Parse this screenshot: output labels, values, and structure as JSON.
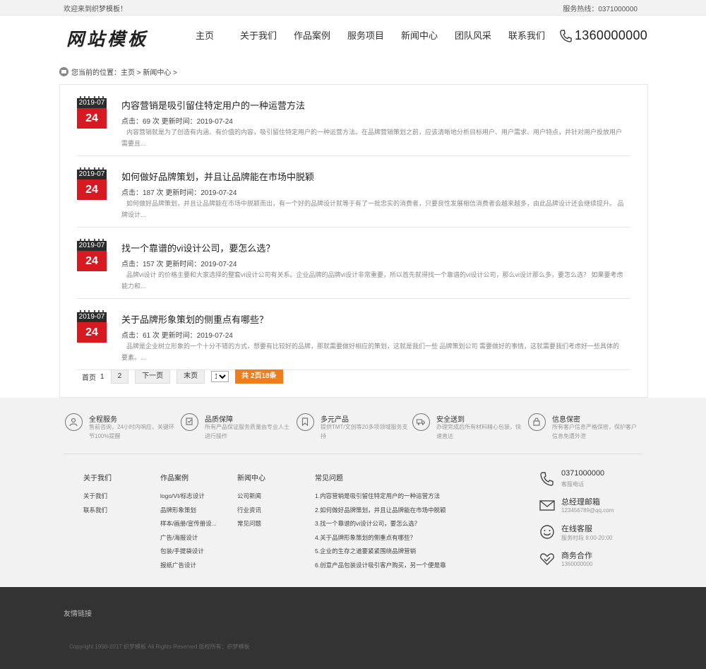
{
  "topbar": {
    "welcome": "欢迎来到织梦模板！",
    "hotline": "服务热线：0371000000"
  },
  "header": {
    "logo": "网站模板",
    "nav": [
      "主页",
      "关于我们",
      "作品案例",
      "服务项目",
      "新闻中心",
      "团队风采",
      "联系我们"
    ],
    "phone": "1360000000"
  },
  "breadcrumb": "您当前的位置：主页 > 新闻中心 >",
  "articles": [
    {
      "ym": "2019-07",
      "day": "24",
      "title": "内容营销是吸引留住特定用户的一种运营方法",
      "meta": "点击：69 次  更新时间：2019-07-24",
      "desc": "内容营销就是为了创造有内涵、有价值的内容，吸引留住特定用户的一种运营方法。在品牌营销策划之前，应该清晰地分析目标用户、用户需求、用户特点，并针对用户投放用户需要且..."
    },
    {
      "ym": "2019-07",
      "day": "24",
      "title": "如何做好品牌策划，并且让品牌能在市场中脱颖",
      "meta": "点击：187 次  更新时间：2019-07-24",
      "desc": "如何做好品牌策划，并且让品牌能在市场中脱颖而出，有一个好的品牌设计就等于有了一批忠实的消费者，只要良性发展相信消费者会越来越多，由此品牌设计还会继续提升。 品牌设计..."
    },
    {
      "ym": "2019-07",
      "day": "24",
      "title": "找一个靠谱的vi设计公司，要怎么选？",
      "meta": "点击：157 次  更新时间：2019-07-24",
      "desc": "品牌vi设计 的价格主要和大家选择的整套vi设计公司有关系。企业品牌的品牌vi设计非常重要，所以首先就得找一个靠谱的vi设计公司，那么vi设计那么多，要怎么选？ 如果要考虑能力和..."
    },
    {
      "ym": "2019-07",
      "day": "24",
      "title": "关于品牌形象策划的侧重点有哪些？",
      "meta": "点击：61 次  更新时间：2019-07-24",
      "desc": "品牌是企业树立形象的一个十分不错的方式，想要有比较好的品牌，那就需要做好相应的策划，这就是我们一些 品牌策划公司 需要做好的事情，这就需要我们考虑好一些具体的要素。..."
    }
  ],
  "pager": {
    "first": "首页",
    "current": "1",
    "page2": "2",
    "next": "下一页",
    "last": "末页",
    "select_value": "1",
    "total": "共 2页18条"
  },
  "services": [
    {
      "title": "全程服务",
      "desc": "售前咨询，24小时内响应，关键环节100%提醒"
    },
    {
      "title": "品质保障",
      "desc": "所有产品保证服务质量由专业人士进行操作"
    },
    {
      "title": "多元产品",
      "desc": "提供TMT/文创等20多项领域服务支持"
    },
    {
      "title": "安全送到",
      "desc": "办理完成后所有材料精心包装，快速直达"
    },
    {
      "title": "信息保密",
      "desc": "所有客户信息严格保密，保护客户信息免遭外泄"
    }
  ],
  "footer_cols": [
    {
      "heading": "关于我们",
      "items": [
        "关于我们",
        "联系我们"
      ]
    },
    {
      "heading": "作品案例",
      "items": [
        "logo/VI/标志设计",
        "品牌形象策划",
        "样本/画册/宣传册设...",
        "广告/海报设计",
        "包装/手提袋设计",
        "报纸广告设计"
      ]
    },
    {
      "heading": "新闻中心",
      "items": [
        "公司新闻",
        "行业资讯",
        "常见问题"
      ]
    },
    {
      "heading": "常见问题",
      "items": [
        "1.内容营销是吸引留住特定用户的一种运营方法",
        "2.如何做好品牌策划，并且让品牌能在市场中脱颖",
        "3.找一个靠谱的vi设计公司，要怎么选？",
        "4.关于品牌形象策划的侧重点有哪些？",
        "5.企业的生存之道要紧紧围绕品牌营销",
        "6.创意产品包装设计吸引客户购买，另一个便是靠"
      ]
    }
  ],
  "contacts": [
    {
      "title": "0371000000",
      "desc": "客服电话"
    },
    {
      "title": "总经理邮箱",
      "desc": "123456789@qq.com"
    },
    {
      "title": "在线客服",
      "desc": "服务时段 8:00-20:00"
    },
    {
      "title": "商务合作",
      "desc": "1360000000"
    }
  ],
  "footer": {
    "links_label": "友情链接",
    "copyright": "Copyright 1998-2017 织梦模板 All Rights Reserved 版权所有：织梦模板"
  },
  "colors": {
    "date_red": "#d71a21",
    "total_orange": "#f07c1a",
    "footer_dark": "#333333",
    "band_gray": "#f2f2f2"
  }
}
